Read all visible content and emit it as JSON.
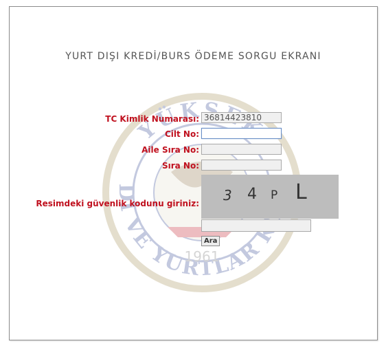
{
  "page": {
    "title": "YURT DIŞI KREDİ/BURS ÖDEME SORGU EKRANI"
  },
  "emblem": {
    "text_top": "YÜKSEK",
    "text_bottom": "KREDİ VE YURTLAR KURUMU",
    "year": "1961"
  },
  "form": {
    "tc_label": "TC Kimlik Numarası:",
    "tc_value": "36814423810",
    "cilt_label": "Cilt No:",
    "cilt_value": "",
    "aile_label": "Aile Sıra No:",
    "aile_value": "",
    "sira_label": "Sıra No:",
    "sira_value": "",
    "captcha_label": "Resimdeki güvenlik kodunu giriniz:",
    "captcha_chars": [
      "3",
      "4",
      "P",
      "L"
    ],
    "captcha_value": "",
    "submit_label": "Ara"
  },
  "colors": {
    "label": "#c0111f",
    "captcha_bg": "#bdbdbd"
  }
}
